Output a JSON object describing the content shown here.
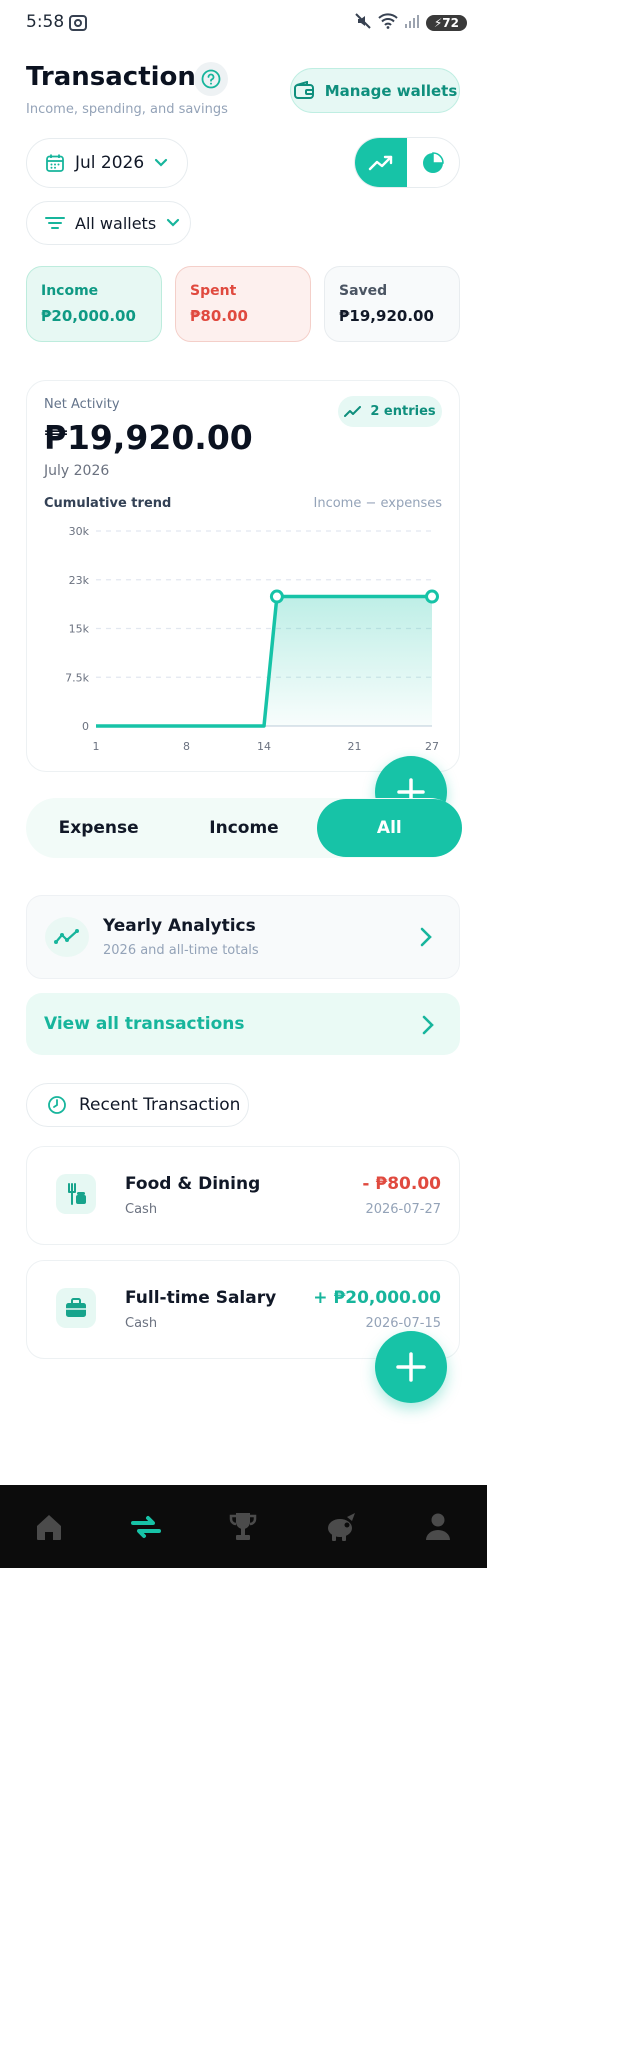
{
  "status": {
    "time": "5:58",
    "battery": "72"
  },
  "header": {
    "title": "Transactions",
    "subtitle": "Income, spending, and savings",
    "manage_wallets": "Manage wallets"
  },
  "filters": {
    "month": "Jul 2026",
    "wallet": "All wallets"
  },
  "summary": [
    {
      "label": "Income",
      "value": "₱20,000.00"
    },
    {
      "label": "Spent",
      "value": "₱80.00"
    },
    {
      "label": "Saved",
      "value": "₱19,920.00"
    }
  ],
  "net": {
    "label": "Net Activity",
    "amount": "₱19,920.00",
    "month": "July 2026",
    "entries": "2 entries",
    "trend_title": "Cumulative trend",
    "trend_note": "Income − expenses"
  },
  "chart_data": {
    "type": "area",
    "x": [
      1,
      14,
      15,
      27
    ],
    "y": [
      0,
      0,
      19920,
      19920
    ],
    "xticks": [
      "1",
      "8",
      "14",
      "21",
      "27"
    ],
    "xtick_values": [
      1,
      8,
      14,
      21,
      27
    ],
    "yticks": [
      "30k",
      "23k",
      "15k",
      "7.5k",
      "0"
    ],
    "ytick_values": [
      30000,
      22500,
      15000,
      7500,
      0
    ],
    "xlim": [
      1,
      27
    ],
    "ylim": [
      0,
      30000
    ],
    "grid": true,
    "color": "#17c3a7"
  },
  "tabs": [
    "Expense",
    "Income",
    "All"
  ],
  "yearly": {
    "title": "Yearly Analytics",
    "subtitle": "2026 and all-time totals"
  },
  "view_all": "View all transactions",
  "recent_title": "Recent Transaction",
  "transactions": [
    {
      "name": "Food & Dining",
      "wallet": "Cash",
      "amount": "- ₱80.00",
      "date": "2026-07-27",
      "icon": "food-icon"
    },
    {
      "name": "Full-time Salary",
      "wallet": "Cash",
      "amount": "+ ₱20,000.00",
      "date": "2026-07-15",
      "icon": "briefcase-icon"
    }
  ],
  "nav": [
    "home-icon",
    "transactions-icon",
    "trophy-icon",
    "piggy-bank-icon",
    "profile-icon"
  ],
  "colors": {
    "accent": "#17c3a7",
    "negative": "#e04a3f",
    "positive": "#17b59c"
  }
}
